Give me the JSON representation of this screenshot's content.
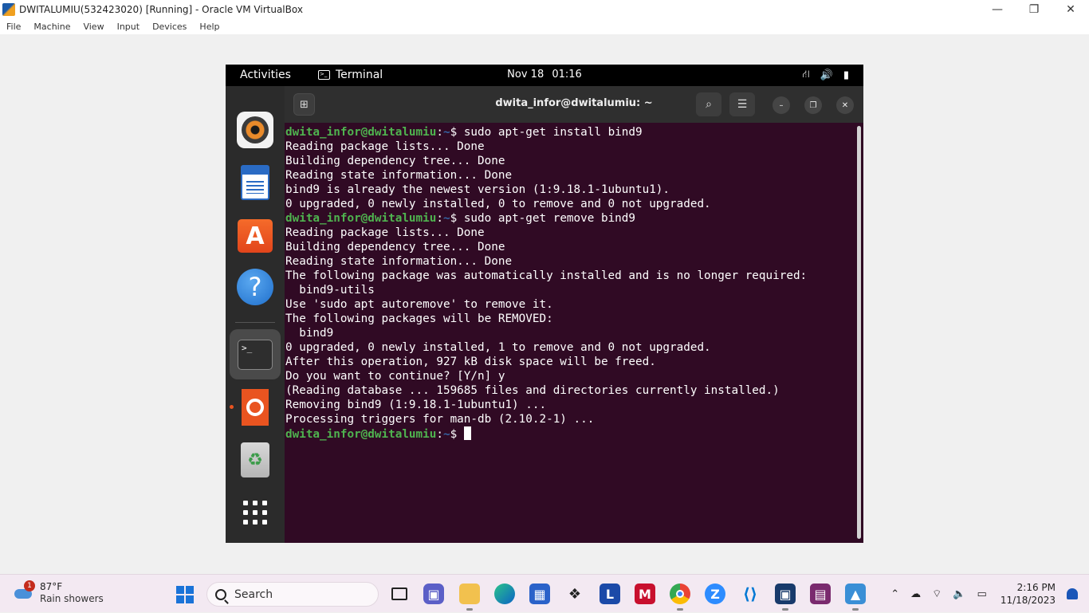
{
  "vbox": {
    "title": "DWITALUMIU(532423020) [Running] - Oracle VM VirtualBox",
    "menu": [
      "File",
      "Machine",
      "View",
      "Input",
      "Devices",
      "Help"
    ],
    "controls": {
      "minimize": "—",
      "restore": "❐",
      "close": "✕"
    }
  },
  "gnome": {
    "activities": "Activities",
    "app_menu": "Terminal",
    "date": "Nov 18",
    "time": "01:16",
    "tray_icons": [
      "network-icon",
      "volume-icon",
      "battery-icon"
    ]
  },
  "dock": {
    "items": [
      "rhythmbox-icon",
      "libreoffice-writer-icon",
      "app-center-icon",
      "help-icon",
      "terminal-icon",
      "ubuntu-icon",
      "trash-icon",
      "show-apps-icon"
    ],
    "running": [
      "terminal-icon",
      "ubuntu-icon"
    ]
  },
  "terminal": {
    "title": "dwita_infor@dwitalumiu: ~",
    "lines": [
      {
        "type": "prompt",
        "user": "dwita_infor@dwitalumiu",
        "path": "~",
        "cmd": "sudo apt-get install bind9"
      },
      {
        "type": "out",
        "text": "Reading package lists... Done"
      },
      {
        "type": "out",
        "text": "Building dependency tree... Done"
      },
      {
        "type": "out",
        "text": "Reading state information... Done"
      },
      {
        "type": "out",
        "text": "bind9 is already the newest version (1:9.18.1-1ubuntu1)."
      },
      {
        "type": "out",
        "text": "0 upgraded, 0 newly installed, 0 to remove and 0 not upgraded."
      },
      {
        "type": "prompt",
        "user": "dwita_infor@dwitalumiu",
        "path": "~",
        "cmd": "sudo apt-get remove bind9"
      },
      {
        "type": "out",
        "text": "Reading package lists... Done"
      },
      {
        "type": "out",
        "text": "Building dependency tree... Done"
      },
      {
        "type": "out",
        "text": "Reading state information... Done"
      },
      {
        "type": "out",
        "text": "The following package was automatically installed and is no longer required:"
      },
      {
        "type": "out",
        "text": "  bind9-utils"
      },
      {
        "type": "out",
        "text": "Use 'sudo apt autoremove' to remove it."
      },
      {
        "type": "out",
        "text": "The following packages will be REMOVED:"
      },
      {
        "type": "out",
        "text": "  bind9"
      },
      {
        "type": "out",
        "text": "0 upgraded, 0 newly installed, 1 to remove and 0 not upgraded."
      },
      {
        "type": "out",
        "text": "After this operation, 927 kB disk space will be freed."
      },
      {
        "type": "out",
        "text": "Do you want to continue? [Y/n] y"
      },
      {
        "type": "out",
        "text": "(Reading database ... 159685 files and directories currently installed.)"
      },
      {
        "type": "out",
        "text": "Removing bind9 (1:9.18.1-1ubuntu1) ..."
      },
      {
        "type": "out",
        "text": "Processing triggers for man-db (2.10.2-1) ..."
      },
      {
        "type": "prompt",
        "user": "dwita_infor@dwitalumiu",
        "path": "~",
        "cmd": "",
        "cursor": true
      }
    ]
  },
  "taskbar": {
    "weather_badge": "1",
    "weather_temp": "87°F",
    "weather_desc": "Rain showers",
    "search_label": "Search",
    "apps": [
      "task-view-icon",
      "teams-icon",
      "file-explorer-icon",
      "edge-icon",
      "store-icon",
      "dropbox-icon",
      "l-app-icon",
      "mcafee-icon",
      "chrome-icon",
      "zoom-icon",
      "vscode-icon",
      "virtualbox-icon",
      "winrar-icon",
      "photos-icon"
    ],
    "clock_time": "2:16 PM",
    "clock_date": "11/18/2023"
  }
}
